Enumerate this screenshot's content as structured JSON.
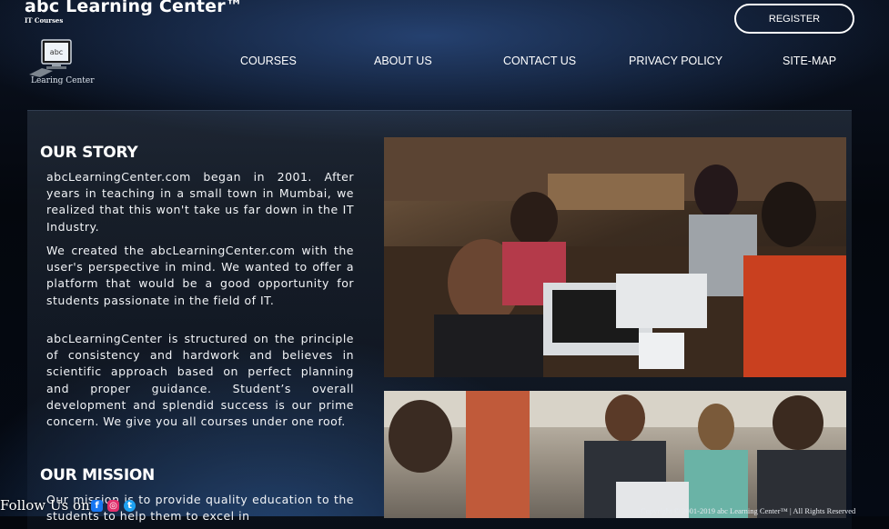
{
  "header": {
    "brand": "abc Learning Center™",
    "tagline": "IT Courses",
    "logo_text": "Learing Center",
    "logo_screen_text": "abc",
    "register_label": "REGISTER"
  },
  "nav": {
    "items": [
      {
        "label": "COURSES"
      },
      {
        "label": "ABOUT US"
      },
      {
        "label": "CONTACT US"
      },
      {
        "label": "PRIVACY POLICY"
      },
      {
        "label": "SITE-MAP"
      }
    ]
  },
  "story": {
    "title": "OUR STORY",
    "paragraphs": [
      "abcLearningCenter.com began in 2001. After years in teaching in a small town in Mumbai, we realized that this won't take us far down in the IT Industry.",
      "We created the abcLearningCenter.com with the user's perspective in mind. We wanted to offer a platform that would be a good opportunity for students passionate in the field of IT.",
      "abcLearningCenter is structured on the principle of consistency and hardwork and believes in scientific approach based on perfect planning and proper guidance. Student’s overall development and splendid success is our prime concern. We give you all courses under one roof."
    ]
  },
  "mission": {
    "title": "OUR MISSION",
    "text": "Our mission is to provide quality education to the students to help them to excel in"
  },
  "footer": {
    "follow_label": "Follow Us on:",
    "social_icons": [
      "facebook-icon",
      "instagram-icon",
      "twitter-icon"
    ],
    "copyright": "Copyright © 2001-2019 abc Learning Center™ | All Rights Reserved"
  },
  "colors": {
    "background": "#04070d",
    "accent_blue": "#3c78c8",
    "facebook": "#1877f2",
    "instagram": "#e1306c",
    "twitter": "#1da1f2"
  }
}
